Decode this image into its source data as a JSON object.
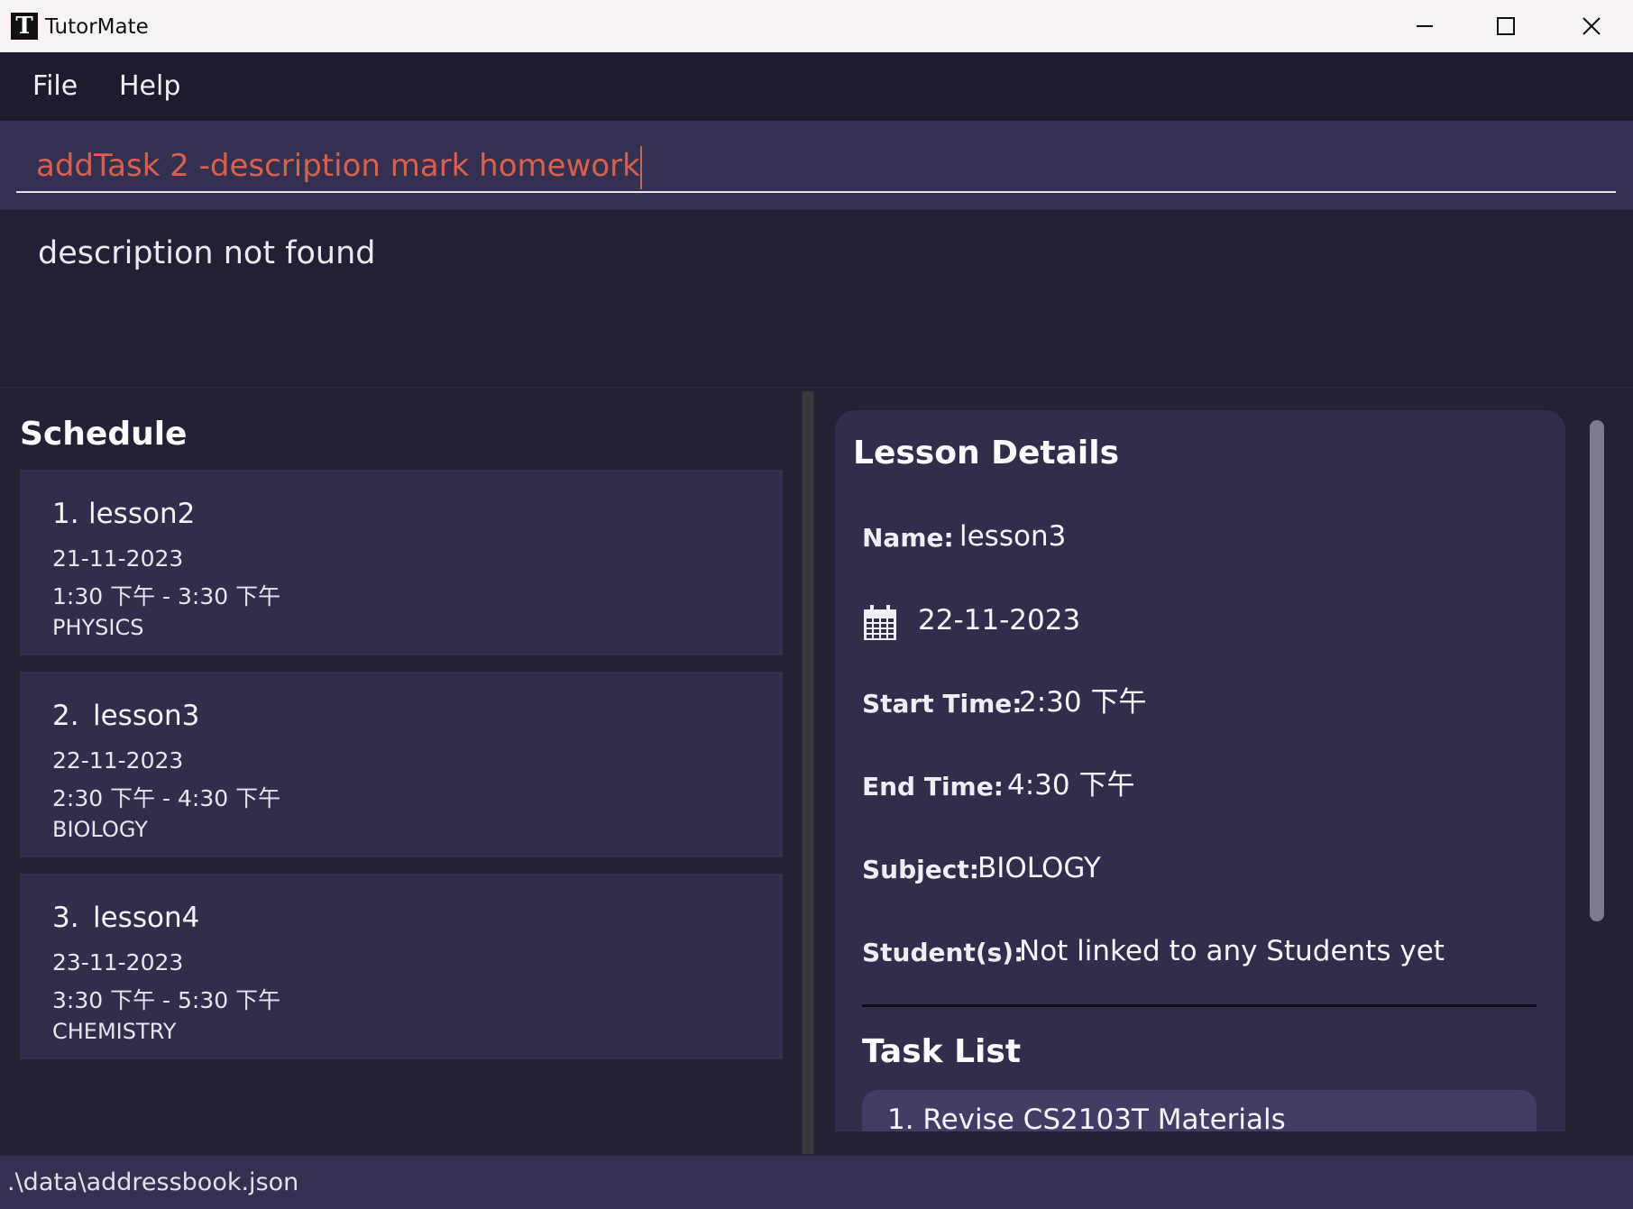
{
  "window": {
    "logo_letter": "T",
    "title": "TutorMate"
  },
  "menu": {
    "file": "File",
    "help": "Help"
  },
  "command": {
    "value": "addTask 2 -description mark homework"
  },
  "result": {
    "message": "description not found"
  },
  "schedule": {
    "title": "Schedule",
    "lessons": [
      {
        "index": "1.",
        "name": "lesson2",
        "date": "21-11-2023",
        "time": "1:30 下午 - 3:30 下午",
        "subject": "PHYSICS"
      },
      {
        "index": "2.",
        "name": "lesson3",
        "date": "22-11-2023",
        "time": "2:30 下午 - 4:30 下午",
        "subject": "BIOLOGY"
      },
      {
        "index": "3.",
        "name": "lesson4",
        "date": "23-11-2023",
        "time": "3:30 下午 - 5:30 下午",
        "subject": "CHEMISTRY"
      }
    ]
  },
  "details": {
    "title": "Lesson Details",
    "name_label": "Name:",
    "name_value": "lesson3",
    "date_value": "22-11-2023",
    "start_label": "Start Time:",
    "start_value": "2:30 下午",
    "end_label": "End Time:",
    "end_value": "4:30 下午",
    "subject_label": "Subject:",
    "subject_value": "BIOLOGY",
    "students_label": "Student(s):",
    "students_value": "Not linked to any Students yet",
    "task_list_title": "Task List",
    "tasks": [
      {
        "text": "1.  Revise CS2103T Materials"
      }
    ]
  },
  "status": {
    "file_path": ".\\data\\addressbook.json"
  },
  "icons": {
    "minimize": "minimize-icon",
    "maximize": "maximize-icon",
    "close": "close-icon",
    "calendar": "calendar-icon"
  }
}
